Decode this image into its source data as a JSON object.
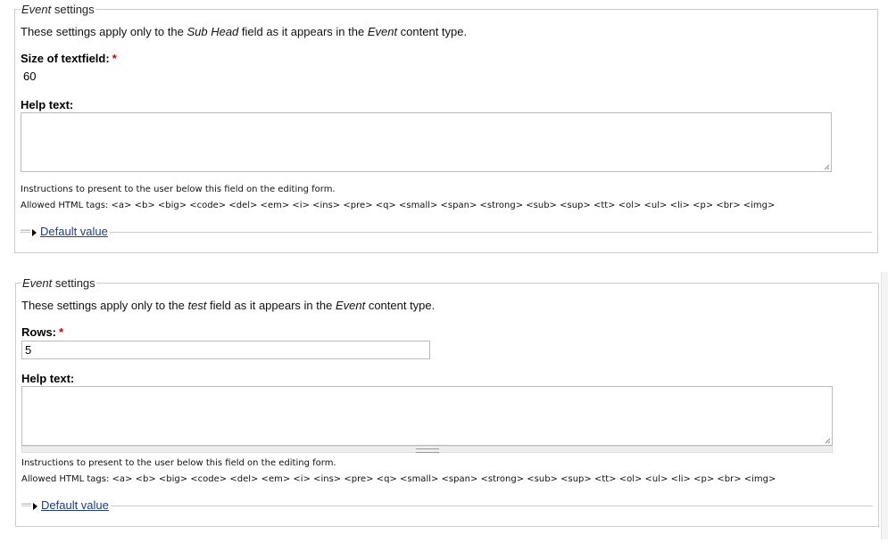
{
  "sections": [
    {
      "legend_prefix": "Event",
      "legend_suffix": " settings",
      "desc_before": "These settings apply only to the ",
      "desc_field": "Sub Head",
      "desc_middle": " field as it appears in the ",
      "desc_type": "Event",
      "desc_after": " content type.",
      "setting_label": "Size of textfield:",
      "setting_value": "60",
      "help_label": "Help text:",
      "help_value": "",
      "instructions": "Instructions to present to the user below this field on the editing form.",
      "allowed_tags": "Allowed HTML tags: <a> <b> <big> <code> <del> <em> <i> <ins> <pre> <q> <small> <span> <strong> <sub> <sup> <tt> <ol> <ul> <li> <p> <br> <img>",
      "default_value_link": "Default value"
    },
    {
      "legend_prefix": "Event",
      "legend_suffix": " settings",
      "desc_before": "These settings apply only to the ",
      "desc_field": "test",
      "desc_middle": " field as it appears in the ",
      "desc_type": "Event",
      "desc_after": " content type.",
      "setting_label": "Rows:",
      "setting_value": "5",
      "help_label": "Help text:",
      "help_value": "",
      "instructions": "Instructions to present to the user below this field on the editing form.",
      "allowed_tags": "Allowed HTML tags: <a> <b> <big> <code> <del> <em> <i> <ins> <pre> <q> <small> <span> <strong> <sub> <sup> <tt> <ol> <ul> <li> <p> <br> <img>",
      "default_value_link": "Default value"
    }
  ],
  "required_marker": "*"
}
